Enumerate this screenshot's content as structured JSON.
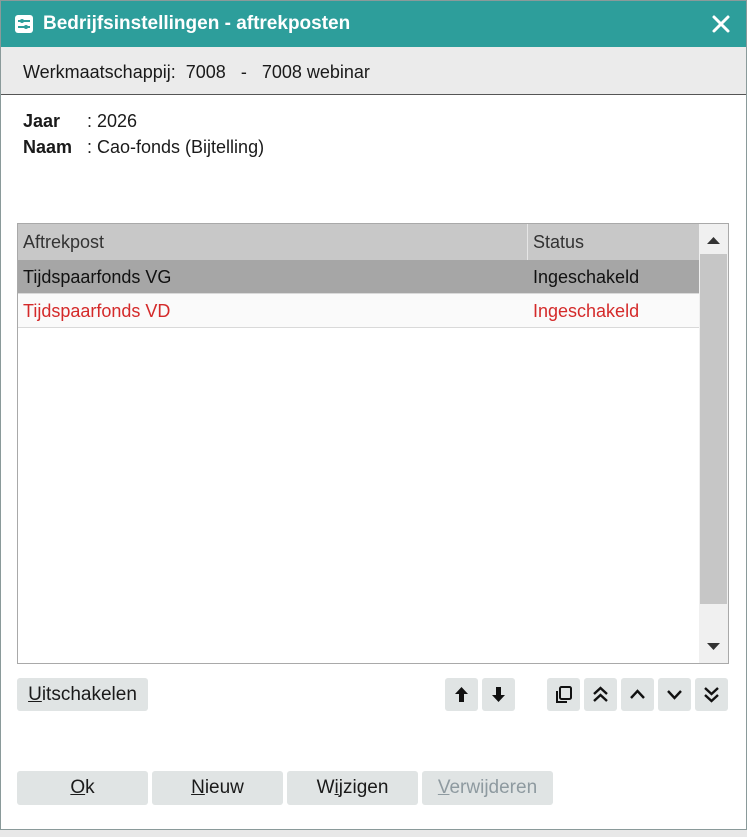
{
  "window": {
    "title": "Bedrijfsinstellingen - aftrekposten",
    "icon": "settings-sliders-icon",
    "close_icon": "close-icon",
    "accent_color": "#2d9e9b"
  },
  "subheader": {
    "label": "Werkmaatschappij:",
    "code": "7008",
    "separator": "-",
    "name": "7008 webinar"
  },
  "info": {
    "jaar_label": "Jaar",
    "jaar_value": ": 2026",
    "naam_label": "Naam",
    "naam_value": ": Cao-fonds (Bijtelling)"
  },
  "table": {
    "columns": [
      "Aftrekpost",
      "Status"
    ],
    "rows": [
      {
        "aftrekpost": "Tijdspaarfonds VG",
        "status": "Ingeschakeld",
        "selected": true
      },
      {
        "aftrekpost": "Tijdspaarfonds VD",
        "status": "Ingeschakeld",
        "selected": false
      }
    ],
    "highlight_color": "#d42a2a"
  },
  "actions": {
    "uitschakelen": {
      "first": "U",
      "rest": "itschakelen"
    },
    "icon_buttons": [
      "arrow-up-icon",
      "arrow-down-icon",
      "copy-icon",
      "chevron-double-up-icon",
      "chevron-up-icon",
      "chevron-down-icon",
      "chevron-double-down-icon"
    ]
  },
  "footer": {
    "ok": {
      "first": "O",
      "rest": "k"
    },
    "nieuw": {
      "first": "N",
      "rest": "ieuw"
    },
    "wijzigen": {
      "first": "W",
      "mid": "i",
      "rest": "jzigen"
    },
    "verwijderen": {
      "first": "V",
      "rest": "erwijderen"
    }
  }
}
